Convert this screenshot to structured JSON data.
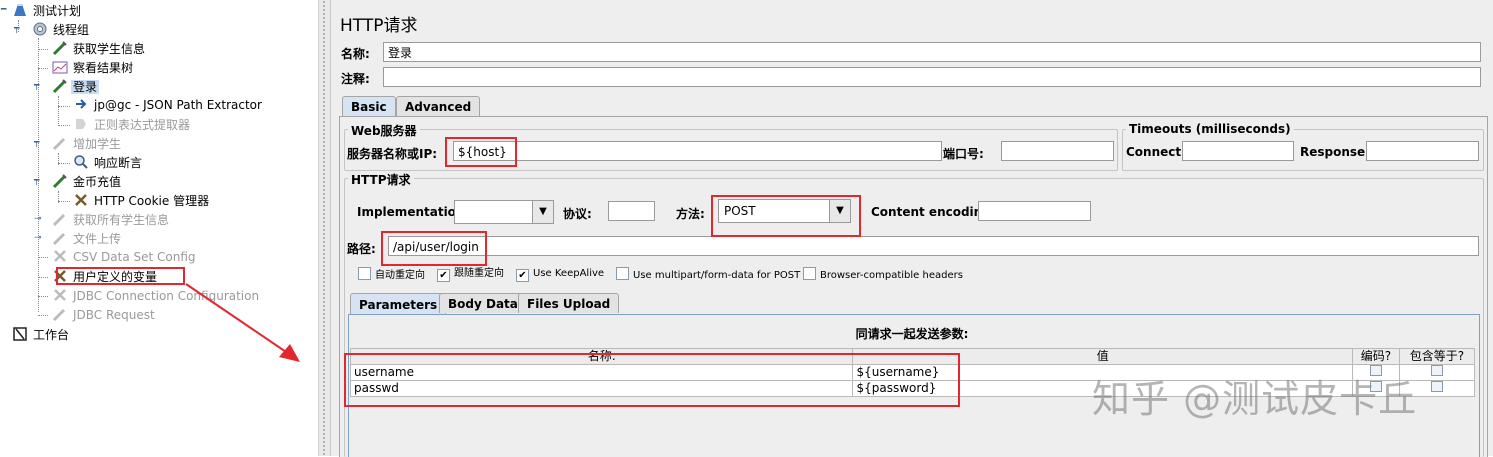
{
  "tree": {
    "nodes": [
      {
        "label": "测试计划",
        "icon": "test-plan-icon"
      },
      {
        "label": "线程组",
        "icon": "thread-group-icon"
      },
      {
        "label": "获取学生信息",
        "icon": "sampler-icon"
      },
      {
        "label": "察看结果树",
        "icon": "listener-icon"
      },
      {
        "label": "登录",
        "icon": "sampler-icon"
      },
      {
        "label": "jp@gc - JSON Path Extractor",
        "icon": "extractor-icon"
      },
      {
        "label": "正则表达式提取器",
        "icon": "extractor-icon"
      },
      {
        "label": "增加学生",
        "icon": "sampler-icon"
      },
      {
        "label": "响应断言",
        "icon": "assertion-icon"
      },
      {
        "label": "金币充值",
        "icon": "sampler-icon"
      },
      {
        "label": "HTTP Cookie 管理器",
        "icon": "config-icon"
      },
      {
        "label": "获取所有学生信息",
        "icon": "sampler-icon"
      },
      {
        "label": "文件上传",
        "icon": "sampler-icon"
      },
      {
        "label": "CSV Data Set Config",
        "icon": "config-icon"
      },
      {
        "label": "用户定义的变量",
        "icon": "config-icon"
      },
      {
        "label": "JDBC Connection Configuration",
        "icon": "config-icon"
      },
      {
        "label": "JDBC Request",
        "icon": "sampler-icon"
      },
      {
        "label": "工作台",
        "icon": "workbench-icon"
      }
    ]
  },
  "panel": {
    "title": "HTTP请求",
    "name_label": "名称:",
    "name_value": "登录",
    "comment_label": "注释:",
    "comment_value": "",
    "tabs": [
      "Basic",
      "Advanced"
    ],
    "web_server": {
      "title": "Web服务器",
      "server_label": "服务器名称或IP:",
      "server_value": "${host}",
      "port_label": "端口号:",
      "port_value": ""
    },
    "timeouts": {
      "title": "Timeouts (milliseconds)",
      "connect_label": "Connect:",
      "connect_value": "",
      "response_label": "Response:",
      "response_value": ""
    },
    "http_request": {
      "title": "HTTP请求",
      "implementation_label": "Implementation:",
      "implementation_value": "",
      "protocol_label": "协议:",
      "protocol_value": "",
      "method_label": "方法:",
      "method_value": "POST",
      "encoding_label": "Content encoding:",
      "encoding_value": "",
      "path_label": "路径:",
      "path_value": "/api/user/login"
    },
    "checkboxes": [
      {
        "label": "自动重定向",
        "checked": false
      },
      {
        "label": "跟随重定向",
        "checked": true
      },
      {
        "label": "Use KeepAlive",
        "checked": true
      },
      {
        "label": "Use multipart/form-data for POST",
        "checked": false
      },
      {
        "label": "Browser-compatible headers",
        "checked": false
      }
    ],
    "subtabs": [
      "Parameters",
      "Body Data",
      "Files Upload"
    ],
    "params": {
      "caption": "同请求一起发送参数:",
      "headers": [
        "名称:",
        "值",
        "编码?",
        "包含等于?"
      ],
      "rows": [
        {
          "name": "username",
          "value": "${username}"
        },
        {
          "name": "passwd",
          "value": "${password}"
        }
      ]
    }
  },
  "watermark": "知乎 @测试皮卡丘",
  "colors": {
    "highlight_red": "#e0282e",
    "selection_blue": "#c9dcf2"
  }
}
